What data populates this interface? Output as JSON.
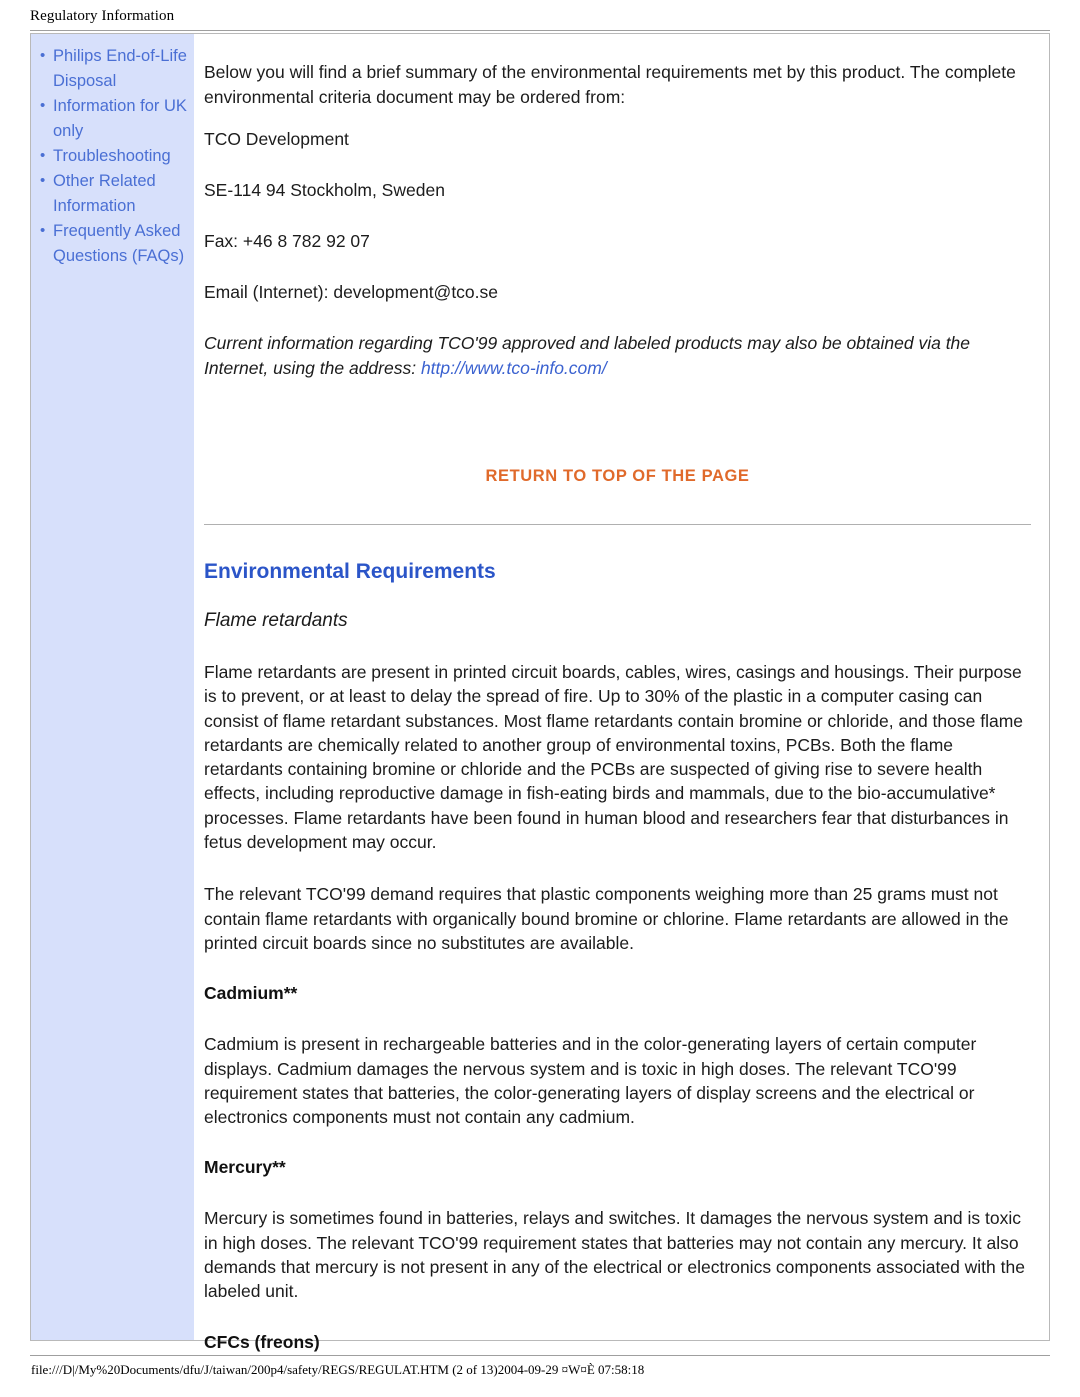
{
  "header": {
    "title": "Regulatory Information"
  },
  "footer": {
    "text": "file:///D|/My%20Documents/dfu/J/taiwan/200p4/safety/REGS/REGULAT.HTM (2 of 13)2004-09-29 ¤W¤È 07:58:18"
  },
  "sidebar": {
    "items": [
      {
        "label": "Philips End-of-Life Disposal"
      },
      {
        "label": "Information for UK only"
      },
      {
        "label": "Troubleshooting"
      },
      {
        "label": "Other Related Information"
      },
      {
        "label": "Frequently Asked Questions (FAQs)"
      }
    ]
  },
  "main": {
    "intro": "Below you will find a brief summary of the environmental requirements met by this product. The complete environmental criteria document may be ordered from:",
    "address": [
      "TCO Development",
      "SE-114 94 Stockholm, Sweden",
      "Fax: +46 8 782 92 07",
      "Email (Internet): development@tco.se"
    ],
    "italic_note_part1": "Current information regarding TCO'99 approved and labeled products may also be obtained via the Internet, using the address: ",
    "italic_note_link": "http://www.tco-info.com/",
    "return_to_top": "RETURN TO TOP OF THE PAGE",
    "section_title": "Environmental Requirements",
    "subsection_title": "Flame retardants",
    "flame_para_1": "Flame retardants are present in printed circuit boards, cables, wires, casings and housings. Their purpose is to prevent, or at least to delay the spread of fire. Up to 30% of the plastic in a computer casing can consist of flame retardant substances. Most flame retardants contain bromine or chloride, and those flame retardants are chemically related to another group of environmental toxins, PCBs. Both the flame retardants containing bromine or chloride and the PCBs are suspected of giving rise to severe health effects, including reproductive damage in fish-eating birds and mammals, due to the bio-accumulative* processes. Flame retardants have been found in human blood and researchers fear that disturbances in fetus development may occur.",
    "flame_para_2": "The relevant TCO'99 demand requires that plastic components weighing more than 25 grams must not contain flame retardants with organically bound bromine or chlorine. Flame retardants are allowed in the printed circuit boards since no substitutes are available.",
    "cadmium_heading": "Cadmium**",
    "cadmium_para": "Cadmium is present in rechargeable batteries and in the color-generating layers of certain computer displays. Cadmium damages the nervous system and is toxic in high doses. The relevant TCO'99 requirement states that batteries, the color-generating layers of display screens and the electrical or electronics components must not contain any cadmium.",
    "mercury_heading": "Mercury**",
    "mercury_para": "Mercury is sometimes found in batteries, relays and switches. It damages the nervous system and is toxic in high doses. The relevant TCO'99 requirement states that batteries may not contain any mercury. It also demands that mercury is not present in any of the electrical or electronics components associated with the labeled unit.",
    "cfc_heading": "CFCs (freons)"
  }
}
